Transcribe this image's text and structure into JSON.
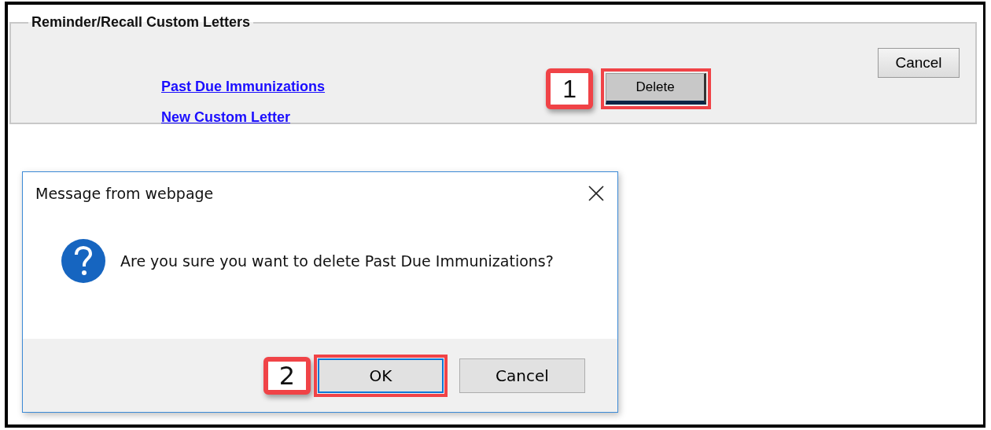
{
  "panel": {
    "title": "Reminder/Recall Custom Letters",
    "links": [
      "Past Due Immunizations",
      "New Custom Letter"
    ],
    "delete_button": {
      "label": "Delete",
      "highlighted": true,
      "step": "1"
    },
    "cancel_button": {
      "label": "Cancel",
      "highlighted": false
    }
  },
  "dialog": {
    "title": "Message from webpage",
    "message": "Are you sure you want to delete Past Due Immunizations?",
    "buttons": [
      {
        "label": "OK",
        "default": true,
        "highlighted": true,
        "step": "2"
      },
      {
        "label": "Cancel",
        "default": false,
        "highlighted": false
      }
    ]
  }
}
